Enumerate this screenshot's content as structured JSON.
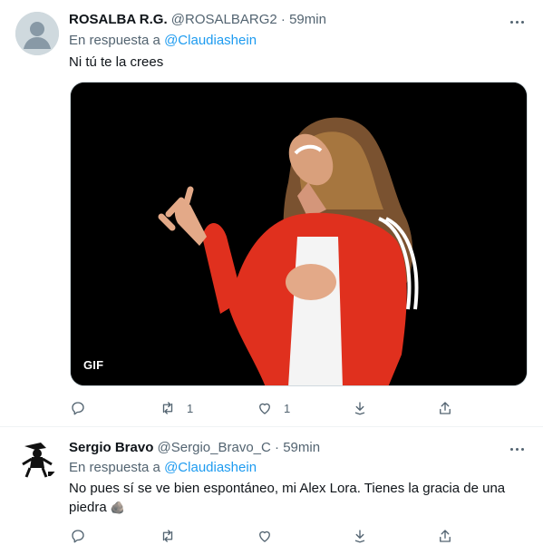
{
  "tweets": [
    {
      "name": "ROSALBA R.G.",
      "handle": "@ROSALBARG2",
      "separator": "·",
      "time": "59min",
      "reply_prefix": "En respuesta a",
      "reply_to": "@Claudiashein",
      "text": "Ni tú te la crees",
      "media_badge": "GIF",
      "actions": {
        "reply": "",
        "retweets": "1",
        "likes": "1"
      }
    },
    {
      "name": "Sergio Bravo",
      "handle": "@Sergio_Bravo_C",
      "separator": "·",
      "time": "59min",
      "reply_prefix": "En respuesta a",
      "reply_to": "@Claudiashein",
      "text": "No pues sí se ve bien espontáneo, mi Alex Lora. Tienes la gracia de una piedra",
      "emoji": "🪨",
      "actions": {
        "reply": "",
        "retweets": "",
        "likes": ""
      }
    }
  ],
  "icons": [
    "avatar-placeholder",
    "more-icon",
    "reply-icon",
    "retweet-icon",
    "like-icon",
    "share-icon",
    "upload-icon"
  ],
  "colors": {
    "link": "#1d9bf0",
    "muted": "#536471",
    "text": "#0f1419",
    "divider": "#eff3f4"
  }
}
